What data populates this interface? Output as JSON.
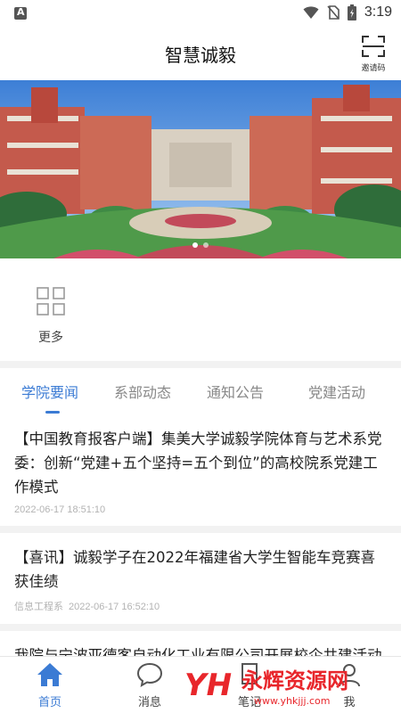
{
  "status": {
    "time": "3:19"
  },
  "header": {
    "title": "智慧诚毅",
    "invite_label": "邀请码"
  },
  "banner": {
    "slides": 2,
    "active": 0
  },
  "shortcuts": [
    {
      "label": "更多",
      "icon": "grid-icon"
    }
  ],
  "tabs": [
    {
      "label": "学院要闻",
      "active": true
    },
    {
      "label": "系部动态",
      "active": false
    },
    {
      "label": "通知公告",
      "active": false
    },
    {
      "label": "党建活动",
      "active": false
    }
  ],
  "news": [
    {
      "title": "【中国教育报客户端】集美大学诚毅学院体育与艺术系党委：创新“党建+五个坚持=五个到位”的高校院系党建工作模式",
      "source": "",
      "date": "2022-06-17 18:51:10"
    },
    {
      "title": "【喜讯】诚毅学子在2022年福建省大学生智能车竞赛喜获佳绩",
      "source": "信息工程系",
      "date": "2022-06-17 16:52:10"
    },
    {
      "title": "我院与宁波亚德客自动化工业有限公司开展校企共建活动",
      "source": "",
      "date": ""
    }
  ],
  "bottom_nav": [
    {
      "label": "首页",
      "icon": "home-icon",
      "active": true
    },
    {
      "label": "消息",
      "icon": "message-icon",
      "active": false
    },
    {
      "label": "笔记",
      "icon": "note-icon",
      "active": false
    },
    {
      "label": "我",
      "icon": "profile-icon",
      "active": false
    }
  ],
  "watermark": {
    "text": "永辉资源网",
    "url": "www.yhkjjj.com"
  },
  "colors": {
    "accent": "#3b7bd4",
    "divider": "#f2f2f2"
  }
}
